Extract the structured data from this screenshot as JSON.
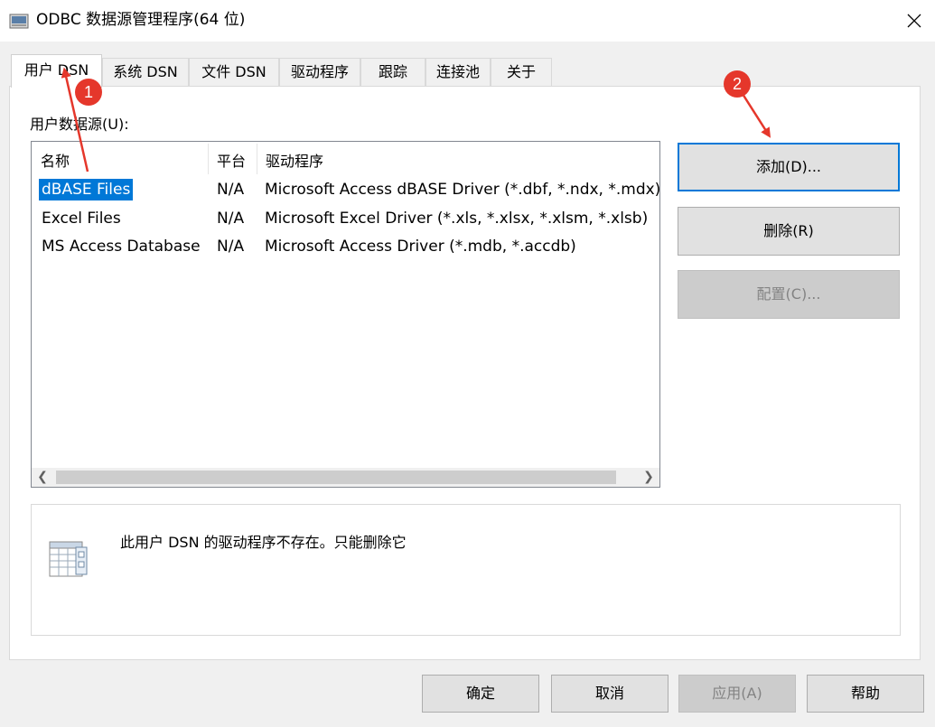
{
  "window": {
    "title": "ODBC 数据源管理程序(64 位)",
    "icon": "odbc-admin-icon"
  },
  "tabs": [
    {
      "label": "用户 DSN",
      "active": true
    },
    {
      "label": "系统 DSN"
    },
    {
      "label": "文件 DSN"
    },
    {
      "label": "驱动程序"
    },
    {
      "label": "跟踪"
    },
    {
      "label": "连接池"
    },
    {
      "label": "关于"
    }
  ],
  "panel": {
    "datasource_label": "用户数据源(U):",
    "columns": {
      "name": "名称",
      "platform": "平台",
      "driver": "驱动程序"
    },
    "rows": [
      {
        "name": "dBASE Files",
        "platform": "N/A",
        "driver": "Microsoft Access dBASE Driver (*.dbf, *.ndx, *.mdx)",
        "selected": true
      },
      {
        "name": "Excel Files",
        "platform": "N/A",
        "driver": "Microsoft Excel Driver (*.xls, *.xlsx, *.xlsm, *.xlsb)"
      },
      {
        "name": "MS Access Database",
        "platform": "N/A",
        "driver": "Microsoft Access Driver (*.mdb, *.accdb)"
      }
    ],
    "buttons": {
      "add": "添加(D)...",
      "remove": "删除(R)",
      "configure": "配置(C)..."
    },
    "info_text": "此用户 DSN 的驱动程序不存在。只能删除它"
  },
  "footer": {
    "ok": "确定",
    "cancel": "取消",
    "apply": "应用(A)",
    "help": "帮助"
  },
  "annotations": [
    {
      "label": "1"
    },
    {
      "label": "2"
    }
  ],
  "colors": {
    "selection": "#0078d7",
    "annotation": "#e5372b",
    "default_button_border": "#0078d7"
  }
}
